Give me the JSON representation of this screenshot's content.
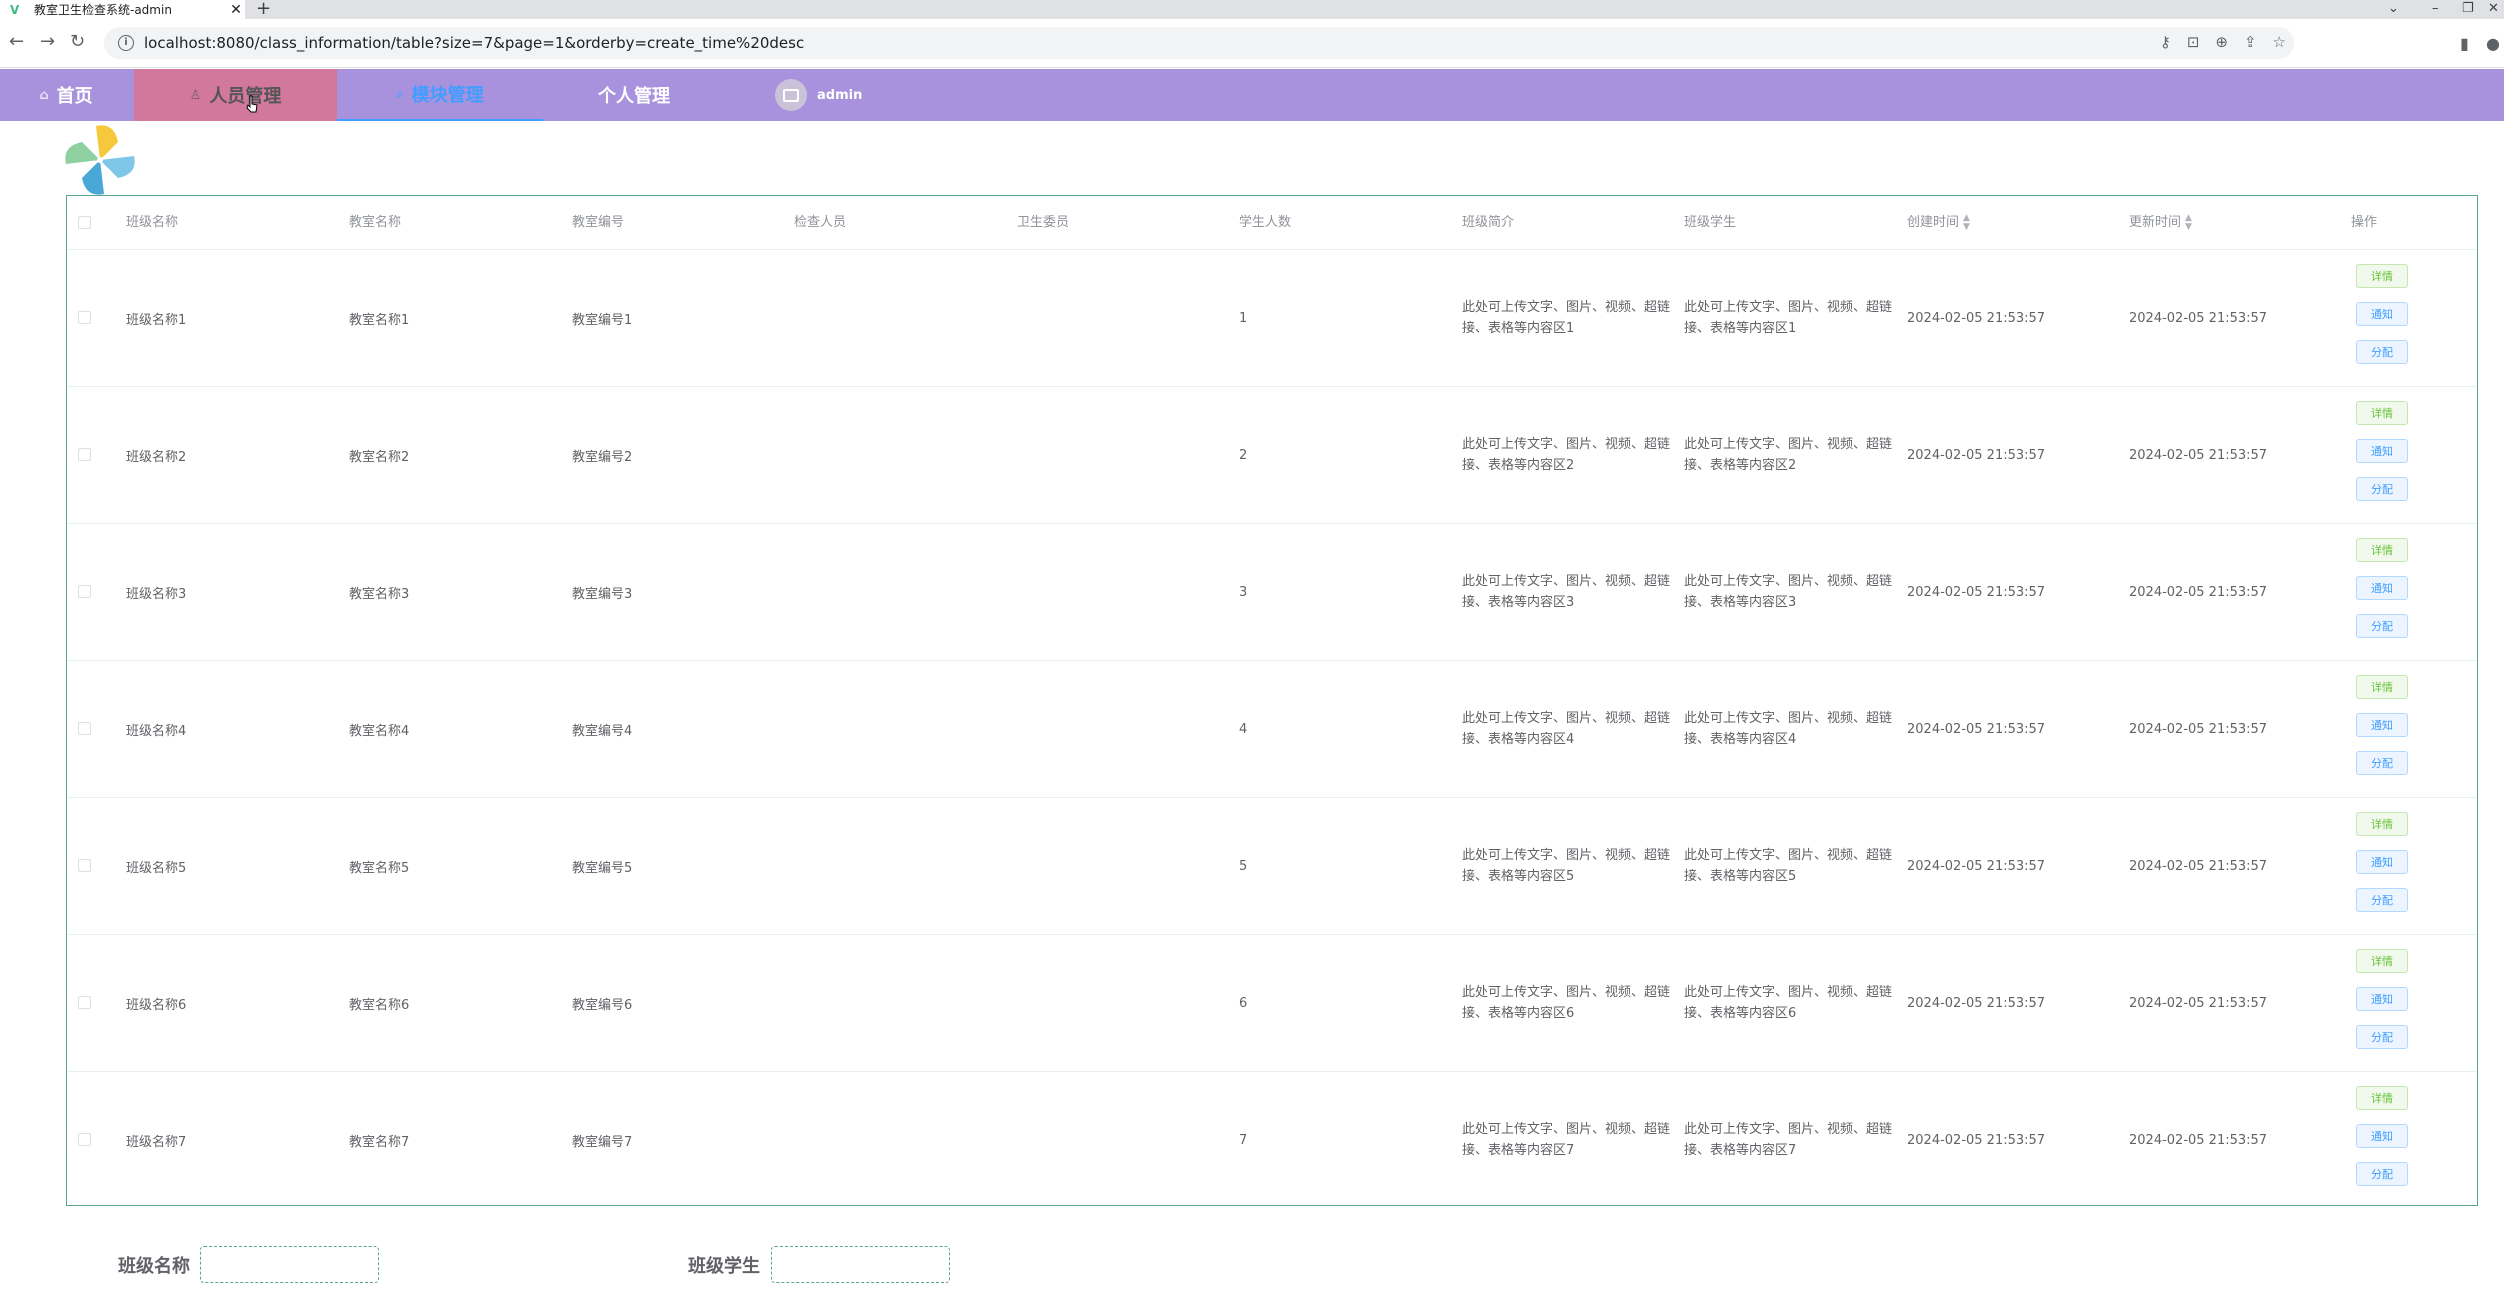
{
  "browser": {
    "tab_title": "教室卫生检查系统-admin",
    "tab_close": "✕",
    "new_tab": "+",
    "url": "localhost:8080/class_information/table?size=7&page=1&orderby=create_time%20desc"
  },
  "nav": {
    "home": "首页",
    "people": "人员管理",
    "module": "模块管理",
    "personal": "个人管理",
    "user": "admin"
  },
  "table": {
    "headers": [
      "班级名称",
      "教室名称",
      "教室编号",
      "检查人员",
      "卫生委员",
      "学生人数",
      "班级简介",
      "班级学生",
      "创建时间",
      "更新时间",
      "操作"
    ],
    "op_labels": {
      "detail": "详情",
      "notify": "通知",
      "assign": "分配"
    },
    "rows": [
      {
        "class_name": "班级名称1",
        "room_name": "教室名称1",
        "room_no": "教室编号1",
        "inspector": "",
        "committee": "",
        "students": "1",
        "intro": "此处可上传文字、图片、视频、超链接、表格等内容区1",
        "class_students": "此处可上传文字、图片、视频、超链接、表格等内容区1",
        "created": "2024-02-05 21:53:57",
        "updated": "2024-02-05 21:53:57"
      },
      {
        "class_name": "班级名称2",
        "room_name": "教室名称2",
        "room_no": "教室编号2",
        "inspector": "",
        "committee": "",
        "students": "2",
        "intro": "此处可上传文字、图片、视频、超链接、表格等内容区2",
        "class_students": "此处可上传文字、图片、视频、超链接、表格等内容区2",
        "created": "2024-02-05 21:53:57",
        "updated": "2024-02-05 21:53:57"
      },
      {
        "class_name": "班级名称3",
        "room_name": "教室名称3",
        "room_no": "教室编号3",
        "inspector": "",
        "committee": "",
        "students": "3",
        "intro": "此处可上传文字、图片、视频、超链接、表格等内容区3",
        "class_students": "此处可上传文字、图片、视频、超链接、表格等内容区3",
        "created": "2024-02-05 21:53:57",
        "updated": "2024-02-05 21:53:57"
      },
      {
        "class_name": "班级名称4",
        "room_name": "教室名称4",
        "room_no": "教室编号4",
        "inspector": "",
        "committee": "",
        "students": "4",
        "intro": "此处可上传文字、图片、视频、超链接、表格等内容区4",
        "class_students": "此处可上传文字、图片、视频、超链接、表格等内容区4",
        "created": "2024-02-05 21:53:57",
        "updated": "2024-02-05 21:53:57"
      },
      {
        "class_name": "班级名称5",
        "room_name": "教室名称5",
        "room_no": "教室编号5",
        "inspector": "",
        "committee": "",
        "students": "5",
        "intro": "此处可上传文字、图片、视频、超链接、表格等内容区5",
        "class_students": "此处可上传文字、图片、视频、超链接、表格等内容区5",
        "created": "2024-02-05 21:53:57",
        "updated": "2024-02-05 21:53:57"
      },
      {
        "class_name": "班级名称6",
        "room_name": "教室名称6",
        "room_no": "教室编号6",
        "inspector": "",
        "committee": "",
        "students": "6",
        "intro": "此处可上传文字、图片、视频、超链接、表格等内容区6",
        "class_students": "此处可上传文字、图片、视频、超链接、表格等内容区6",
        "created": "2024-02-05 21:53:57",
        "updated": "2024-02-05 21:53:57"
      },
      {
        "class_name": "班级名称7",
        "room_name": "教室名称7",
        "room_no": "教室编号7",
        "inspector": "",
        "committee": "",
        "students": "7",
        "intro": "此处可上传文字、图片、视频、超链接、表格等内容区7",
        "class_students": "此处可上传文字、图片、视频、超链接、表格等内容区7",
        "created": "2024-02-05 21:53:57",
        "updated": "2024-02-05 21:53:57"
      }
    ]
  },
  "form": {
    "class_name_label": "班级名称",
    "class_name_value": "",
    "class_students_label": "班级学生",
    "class_students_value": ""
  }
}
